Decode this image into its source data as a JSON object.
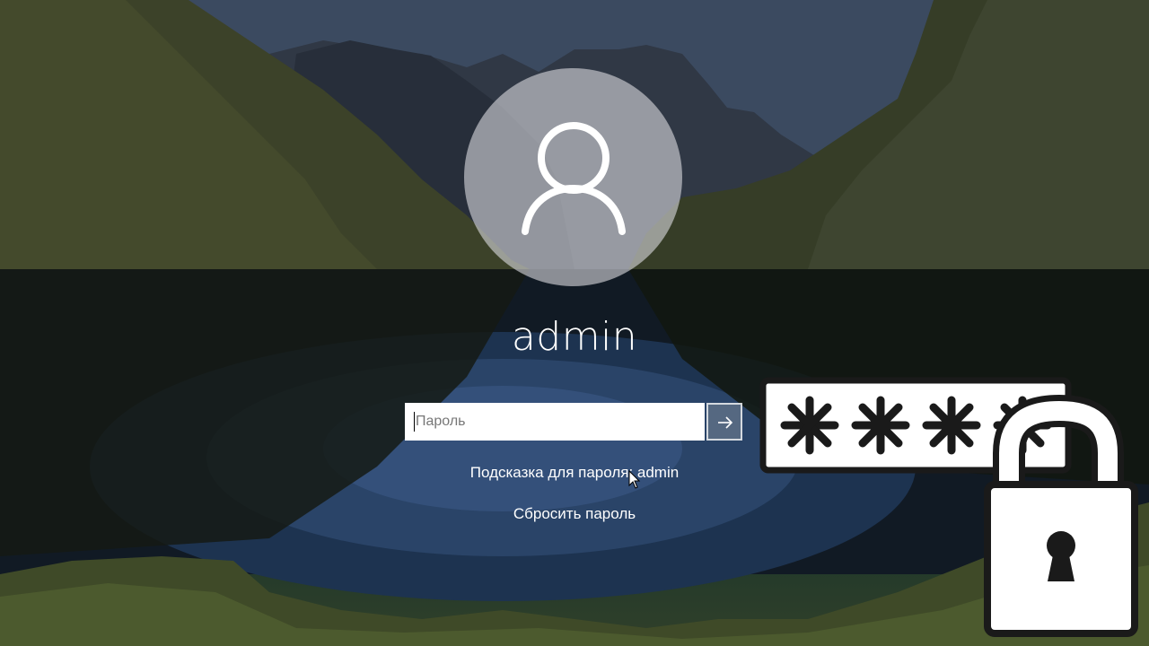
{
  "login": {
    "username": "admin",
    "password_placeholder": "Пароль",
    "hint": "Подсказка для пароля: admin",
    "reset_password": "Сбросить пароль"
  },
  "icons": {
    "avatar": "user-silhouette-icon",
    "submit": "arrow-right-icon",
    "overlay_lock": "padlock-icon",
    "overlay_asterisks": "password-asterisks-icon",
    "cursor": "mouse-pointer-icon"
  },
  "colors": {
    "text": "#ffffff",
    "input_bg": "#ffffff",
    "placeholder": "#777777",
    "overlay_outline": "#1a1a1a"
  }
}
